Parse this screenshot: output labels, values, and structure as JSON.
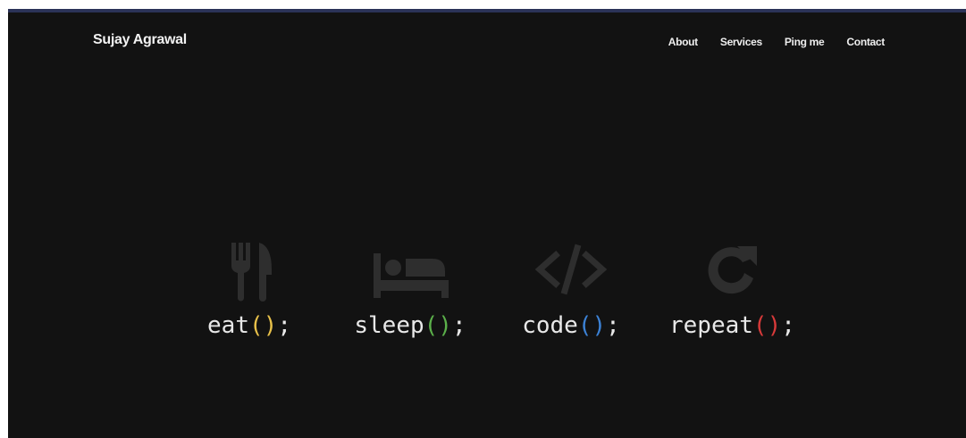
{
  "header": {
    "brand": "Sujay Agrawal",
    "nav": [
      {
        "label": "About"
      },
      {
        "label": "Services"
      },
      {
        "label": "Ping me"
      },
      {
        "label": "Contact"
      }
    ]
  },
  "hero": {
    "items": [
      {
        "icon": "utensils-icon",
        "fn": "eat",
        "parens": "()",
        "suffix": ";",
        "paren_color": "#e8c14a"
      },
      {
        "icon": "bed-icon",
        "fn": "sleep",
        "parens": "()",
        "suffix": ";",
        "paren_color": "#5bb04a"
      },
      {
        "icon": "code-icon",
        "fn": "code",
        "parens": "()",
        "suffix": ";",
        "paren_color": "#3c82d6"
      },
      {
        "icon": "redo-icon",
        "fn": "repeat",
        "parens": "()",
        "suffix": ";",
        "paren_color": "#d83a3a"
      }
    ]
  },
  "colors": {
    "background": "#121212",
    "icon": "#2e2e2e",
    "text": "#e8e8e8",
    "topline": "#2b3358"
  }
}
